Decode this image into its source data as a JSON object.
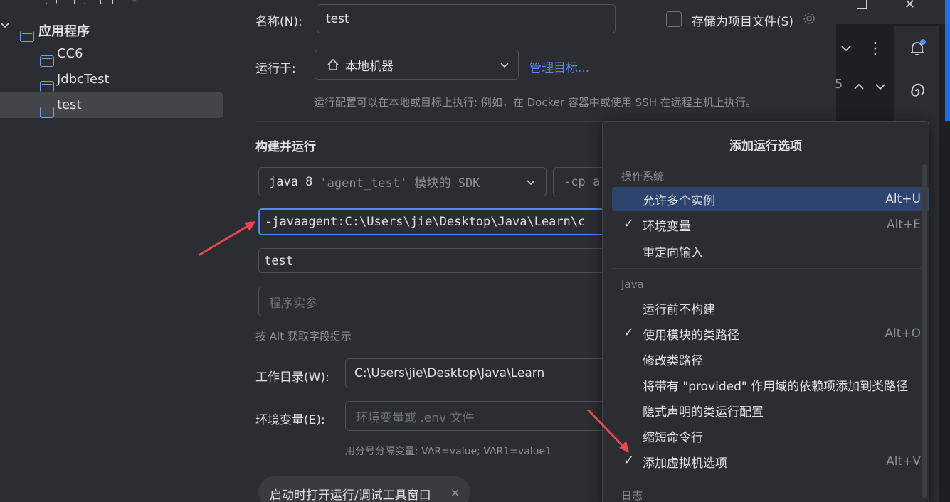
{
  "tree": {
    "root_label": "应用程序",
    "items": [
      "CC6",
      "JdbcTest",
      "test"
    ]
  },
  "form": {
    "name_label": "名称(N):",
    "name_value": "test",
    "store_label": "存储为项目文件(S)",
    "run_on_label": "运行于:",
    "run_on_value": "本地机器",
    "manage_targets": "管理目标...",
    "run_hint": "运行配置可以在本地或目标上执行: 例如，在 Docker 容器中或使用 SSH 在远程主机上执行。",
    "build_title": "构建并运行",
    "sdk_value_java": "java 8",
    "sdk_value_module": "'agent_test' 模块的 SDK",
    "cp_value": "-cp a",
    "vm_options": "-javaagent:C:\\Users\\jie\\Desktop\\Java\\Learn\\c",
    "main_class": "test",
    "program_args_placeholder": "程序实参",
    "alt_hint": "按 Alt 获取字段提示",
    "workdir_label": "工作目录(W):",
    "workdir_value": "C:\\Users\\jie\\Desktop\\Java\\Learn",
    "env_label": "环境变量(E):",
    "env_placeholder": "环境变量或 .env 文件",
    "env_hint": "用分号分隔变量: VAR=value; VAR1=value1",
    "chip_label": "启动时打开运行/调试工具窗口"
  },
  "right_strip": {
    "counter": "5"
  },
  "popup": {
    "title": "添加运行选项",
    "section_os": "操作系统",
    "section_java": "Java",
    "section_log": "日志",
    "items": [
      {
        "label": "允许多个实例",
        "shortcut": "Alt+U",
        "checked": false
      },
      {
        "label": "环境变量",
        "shortcut": "Alt+E",
        "checked": true
      },
      {
        "label": "重定向输入",
        "shortcut": "",
        "checked": false
      },
      {
        "label": "运行前不构建",
        "shortcut": "",
        "checked": false
      },
      {
        "label": "使用模块的类路径",
        "shortcut": "Alt+O",
        "checked": true
      },
      {
        "label": "修改类路径",
        "shortcut": "",
        "checked": false
      },
      {
        "label": "将带有 \"provided\" 作用域的依赖项添加到类路径",
        "shortcut": "",
        "checked": false
      },
      {
        "label": "隐式声明的类运行配置",
        "shortcut": "",
        "checked": false
      },
      {
        "label": "缩短命令行",
        "shortcut": "",
        "checked": false
      },
      {
        "label": "添加虚拟机选项",
        "shortcut": "Alt+V",
        "checked": true
      }
    ],
    "check_mark": "✓"
  },
  "colors": {
    "accent": "#548af7",
    "selection": "#2e436e",
    "arrow": "#e8474f",
    "link": "#548af7"
  }
}
